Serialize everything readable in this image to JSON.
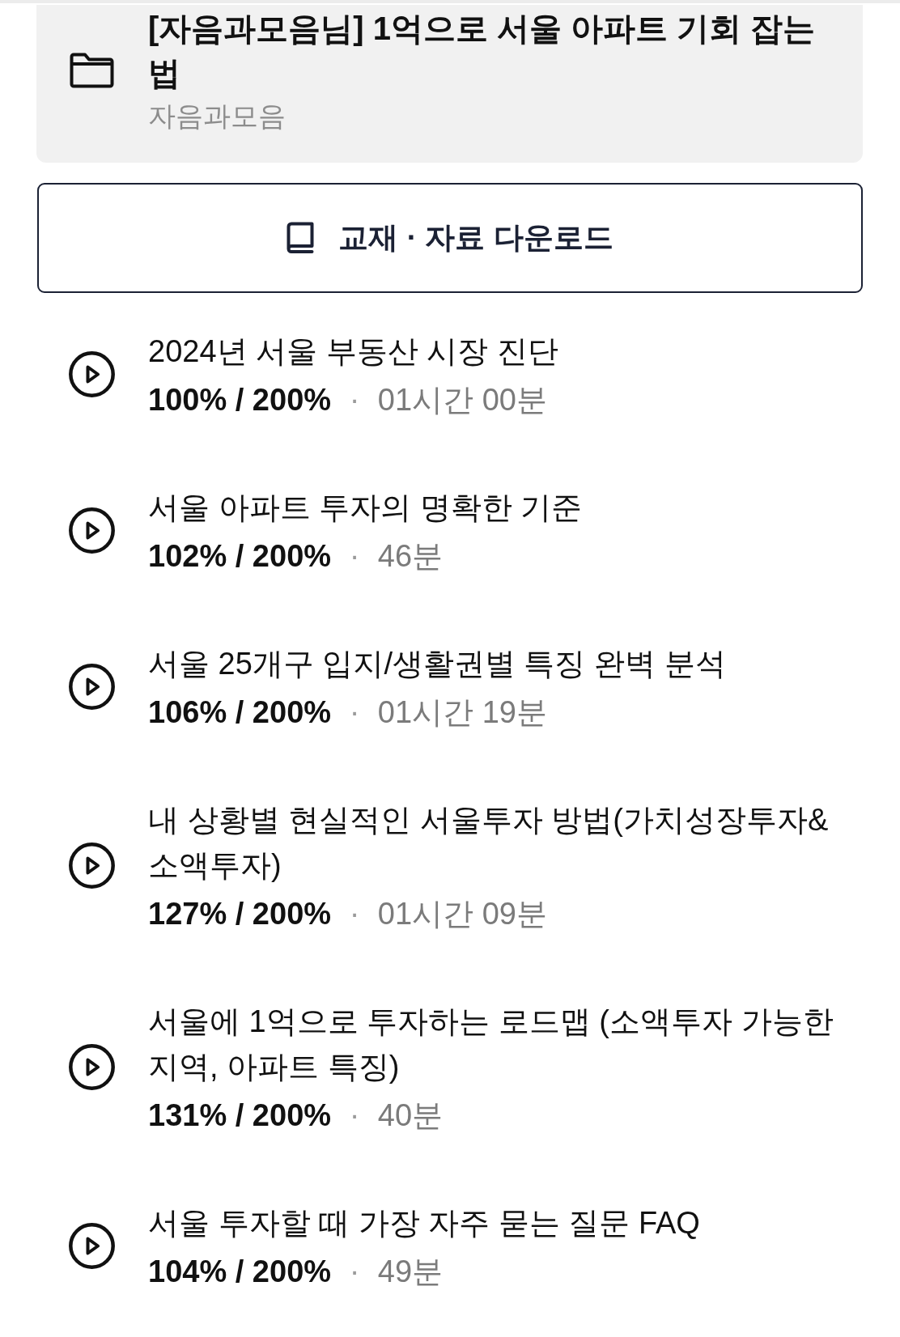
{
  "course": {
    "title": "[자음과모음님] 1억으로 서울 아파트 기회 잡는 법",
    "author": "자음과모음"
  },
  "download_button": {
    "label": "교재 · 자료 다운로드"
  },
  "lectures": [
    {
      "title": "2024년 서울 부동산 시장 진단",
      "progress": "100% / 200%",
      "separator": "·",
      "duration": "01시간 00분"
    },
    {
      "title": "서울 아파트 투자의 명확한 기준",
      "progress": "102% / 200%",
      "separator": "·",
      "duration": "46분"
    },
    {
      "title": "서울 25개구 입지/생활권별 특징 완벽 분석",
      "progress": "106% / 200%",
      "separator": "·",
      "duration": "01시간 19분"
    },
    {
      "title": "내 상황별 현실적인 서울투자 방법(가치성장투자&소액투자)",
      "progress": "127% / 200%",
      "separator": "·",
      "duration": "01시간 09분"
    },
    {
      "title": "서울에 1억으로 투자하는 로드맵 (소액투자 가능한 지역, 아파트 특징)",
      "progress": "131% / 200%",
      "separator": "·",
      "duration": "40분"
    },
    {
      "title": "서울 투자할 때 가장 자주 묻는 질문 FAQ",
      "progress": "104% / 200%",
      "separator": "·",
      "duration": "49분"
    }
  ]
}
